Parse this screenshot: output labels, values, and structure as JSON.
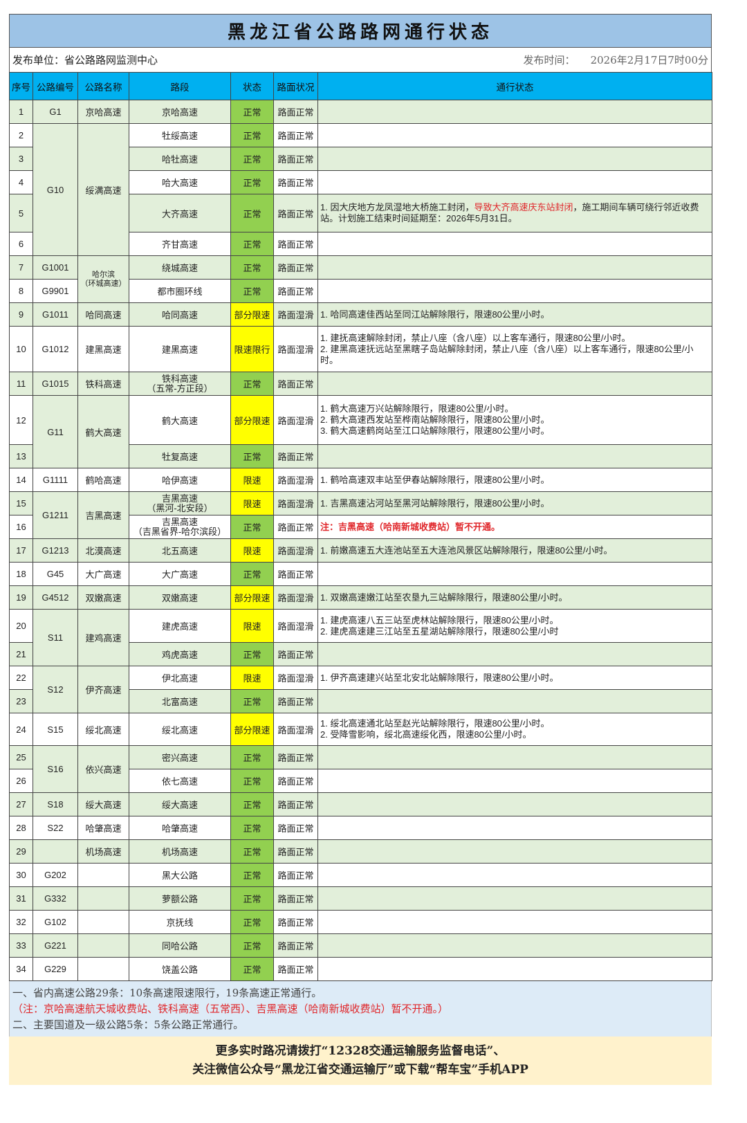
{
  "title": "黑龙江省公路路网通行状态",
  "publisher": "发布单位：省公路路网监测中心",
  "publish_time_label": "发布时间：",
  "publish_time": "2026年2月17日7时00分",
  "columns": [
    "序号",
    "公路编号",
    "公路名称",
    "路段",
    "状态",
    "路面状况",
    "通行状态"
  ],
  "colors": {
    "normal": "#92d050",
    "limited": "#ffff00",
    "header": "#00b0f0",
    "title": "#9dc3e6",
    "alert": "#e0262a"
  },
  "rows": [
    {
      "no": "1",
      "code": "G1",
      "code_span": 1,
      "name": "京哈高速",
      "name_span": 1,
      "segment": "京哈高速",
      "status": "正常",
      "surface": "路面正常",
      "notes": []
    },
    {
      "no": "2",
      "code": "G10",
      "code_span": 5,
      "name": "绥满高速",
      "name_span": 5,
      "segment": "牡绥高速",
      "status": "正常",
      "surface": "路面正常",
      "notes": []
    },
    {
      "no": "3",
      "segment": "哈牡高速",
      "status": "正常",
      "surface": "路面正常",
      "notes": []
    },
    {
      "no": "4",
      "segment": "哈大高速",
      "status": "正常",
      "surface": "路面正常",
      "notes": []
    },
    {
      "no": "5",
      "segment": "大齐高速",
      "status": "正常",
      "surface": "路面正常",
      "notes": [
        [
          {
            "t": "1. 因大庆地方龙凤湿地大桥施工封闭，"
          },
          {
            "t": "导致大齐高速庆东站封闭",
            "s": "red"
          },
          {
            "t": "，施工期间车辆可绕行邻近收费站。计划施工结束时间延期至：2026年5月31日。"
          }
        ]
      ]
    },
    {
      "no": "6",
      "segment": "齐甘高速",
      "status": "正常",
      "surface": "路面正常",
      "notes": []
    },
    {
      "no": "7",
      "code": "G1001",
      "code_span": 1,
      "name": "哈尔滨\n（环城高速）",
      "name_span": 2,
      "name_small": true,
      "segment": "绕城高速",
      "status": "正常",
      "surface": "路面正常",
      "notes": []
    },
    {
      "no": "8",
      "code": "G9901",
      "code_span": 1,
      "segment": "都市圈环线",
      "status": "正常",
      "surface": "路面正常",
      "notes": []
    },
    {
      "no": "9",
      "code": "G1011",
      "code_span": 1,
      "name": "哈同高速",
      "name_span": 1,
      "segment": "哈同高速",
      "status": "部分限速",
      "surface": "路面湿滑",
      "notes": [
        [
          {
            "t": "1. 哈同高速佳西站至同江站解除限行，限速80公里/小时。"
          }
        ]
      ]
    },
    {
      "no": "10",
      "code": "G1012",
      "code_span": 1,
      "name": "建黑高速",
      "name_span": 1,
      "segment": "建黑高速",
      "status": "限速限行",
      "surface": "路面湿滑",
      "notes": [
        [
          {
            "t": "1. 建抚高速解除封闭，禁止八座（含八座）以上客车通行，限速80公里/小时。"
          }
        ],
        [
          {
            "t": "2. 建黑高速抚远站至黑瞎子岛站解除封闭，禁止八座（含八座）以上客车通行，限速80公里/小时。"
          }
        ]
      ]
    },
    {
      "no": "11",
      "code": "G1015",
      "code_span": 1,
      "name": "铁科高速",
      "name_span": 1,
      "segment": "铁科高速\n（五常-方正段）",
      "status": "正常",
      "surface": "路面正常",
      "notes": []
    },
    {
      "no": "12",
      "code": "G11",
      "code_span": 2,
      "name": "鹤大高速",
      "name_span": 2,
      "segment": "鹤大高速",
      "status": "部分限速",
      "surface": "路面湿滑",
      "notes": [
        [
          {
            "t": "1. 鹤大高速万兴站解除限行，限速80公里/小时。"
          }
        ],
        [
          {
            "t": "2. 鹤大高速西发站至桦南站解除限行，限速80公里/小时。"
          }
        ],
        [
          {
            "t": "3. 鹤大高速鹤岗站至江口站解除限行，限速80公里/小时。"
          }
        ]
      ]
    },
    {
      "no": "13",
      "segment": "牡复高速",
      "status": "正常",
      "surface": "路面正常",
      "notes": []
    },
    {
      "no": "14",
      "code": "G1111",
      "code_span": 1,
      "name": "鹤哈高速",
      "name_span": 1,
      "segment": "哈伊高速",
      "status": "限速",
      "surface": "路面湿滑",
      "notes": [
        [
          {
            "t": "1. 鹤哈高速双丰站至伊春站解除限行，限速80公里/小时。"
          }
        ]
      ]
    },
    {
      "no": "15",
      "code": "G1211",
      "code_span": 2,
      "name": "吉黑高速",
      "name_span": 2,
      "segment": "吉黑高速\n（黑河-北安段）",
      "status": "限速",
      "surface": "路面湿滑",
      "notes": [
        [
          {
            "t": "1. 吉黑高速沾河站至黑河站解除限行，限速80公里/小时。"
          }
        ]
      ]
    },
    {
      "no": "16",
      "segment": "吉黑高速\n（吉黑省界-哈尔滨段）",
      "status": "正常",
      "surface": "路面正常",
      "notes": [
        [
          {
            "t": "注：吉黑高速（哈南新城收费站）暂不开通。",
            "s": "redb"
          }
        ]
      ]
    },
    {
      "no": "17",
      "code": "G1213",
      "code_span": 1,
      "name": "北漠高速",
      "name_span": 1,
      "segment": "北五高速",
      "status": "限速",
      "surface": "路面湿滑",
      "notes": [
        [
          {
            "t": "1. 前嫩高速五大连池站至五大连池风景区站解除限行，限速80公里/小时。"
          }
        ]
      ]
    },
    {
      "no": "18",
      "code": "G45",
      "code_span": 1,
      "name": "大广高速",
      "name_span": 1,
      "segment": "大广高速",
      "status": "正常",
      "surface": "路面正常",
      "notes": []
    },
    {
      "no": "19",
      "code": "G4512",
      "code_span": 1,
      "name": "双嫩高速",
      "name_span": 1,
      "segment": "双嫩高速",
      "status": "部分限速",
      "surface": "路面湿滑",
      "notes": [
        [
          {
            "t": "1. 双嫩高速嫩江站至农垦九三站解除限行，限速80公里/小时。"
          }
        ]
      ]
    },
    {
      "no": "20",
      "code": "S11",
      "code_span": 2,
      "name": "建鸡高速",
      "name_span": 2,
      "segment": "建虎高速",
      "status": "限速",
      "surface": "路面湿滑",
      "notes": [
        [
          {
            "t": "1. 建虎高速八五三站至虎林站解除限行，限速80公里/小时。"
          }
        ],
        [
          {
            "t": "2. 建虎高速建三江站至五星湖站解除限行，限速80公里/小时"
          }
        ]
      ]
    },
    {
      "no": "21",
      "segment": "鸡虎高速",
      "status": "正常",
      "surface": "路面正常",
      "notes": []
    },
    {
      "no": "22",
      "code": "S12",
      "code_span": 2,
      "name": "伊齐高速",
      "name_span": 2,
      "segment": "伊北高速",
      "status": "限速",
      "surface": "路面湿滑",
      "notes": [
        [
          {
            "t": "1. 伊齐高速建兴站至北安北站解除限行，限速80公里/小时。"
          }
        ]
      ]
    },
    {
      "no": "23",
      "segment": "北富高速",
      "status": "正常",
      "surface": "路面正常",
      "notes": []
    },
    {
      "no": "24",
      "code": "S15",
      "code_span": 1,
      "name": "绥北高速",
      "name_span": 1,
      "segment": "绥北高速",
      "status": "部分限速",
      "surface": "路面湿滑",
      "notes": [
        [
          {
            "t": "1. 绥北高速通北站至赵光站解除限行，限速80公里/小时。"
          }
        ],
        [
          {
            "t": "2. 受降雪影响，绥北高速绥化西，限速80公里/小时。"
          }
        ]
      ]
    },
    {
      "no": "25",
      "code": "S16",
      "code_span": 2,
      "name": "依兴高速",
      "name_span": 2,
      "segment": "密兴高速",
      "status": "正常",
      "surface": "路面正常",
      "notes": []
    },
    {
      "no": "26",
      "segment": "依七高速",
      "status": "正常",
      "surface": "路面正常",
      "notes": []
    },
    {
      "no": "27",
      "code": "S18",
      "code_span": 1,
      "name": "绥大高速",
      "name_span": 1,
      "segment": "绥大高速",
      "status": "正常",
      "surface": "路面正常",
      "notes": []
    },
    {
      "no": "28",
      "code": "S22",
      "code_span": 1,
      "name": "哈肇高速",
      "name_span": 1,
      "segment": "哈肇高速",
      "status": "正常",
      "surface": "路面正常",
      "notes": []
    },
    {
      "no": "29",
      "code": "",
      "code_span": 1,
      "name": "机场高速",
      "name_span": 1,
      "segment": "机场高速",
      "status": "正常",
      "surface": "路面正常",
      "notes": []
    },
    {
      "no": "30",
      "code": "G202",
      "code_span": 1,
      "name": "",
      "name_span": 1,
      "segment": "黑大公路",
      "status": "正常",
      "surface": "路面正常",
      "notes": []
    },
    {
      "no": "31",
      "code": "G332",
      "code_span": 1,
      "name": "",
      "name_span": 1,
      "segment": "萝额公路",
      "status": "正常",
      "surface": "路面正常",
      "notes": []
    },
    {
      "no": "32",
      "code": "G102",
      "code_span": 1,
      "name": "",
      "name_span": 1,
      "segment": "京抚线",
      "status": "正常",
      "surface": "路面正常",
      "notes": []
    },
    {
      "no": "33",
      "code": "G221",
      "code_span": 1,
      "name": "",
      "name_span": 1,
      "segment": "同哈公路",
      "status": "正常",
      "surface": "路面正常",
      "notes": []
    },
    {
      "no": "34",
      "code": "G229",
      "code_span": 1,
      "name": "",
      "name_span": 1,
      "segment": "饶盖公路",
      "status": "正常",
      "surface": "路面正常",
      "notes": []
    }
  ],
  "summary": {
    "line1": "一、省内高速公路29条：10条高速限速限行，19条高速正常通行。",
    "note": "（注：京哈高速航天城收费站、铁科高速（五常西）、吉黑高速（哈南新城收费站）暂不开通。）",
    "line2": "二、主要国道及一级公路5条：5条公路正常通行。"
  },
  "contact": {
    "line1": "更多实时路况请拨打“12328交通运输服务监督电话”、",
    "line2": "关注微信公众号“黑龙江省交通运输厅”或下载“帮车宝”手机APP"
  }
}
